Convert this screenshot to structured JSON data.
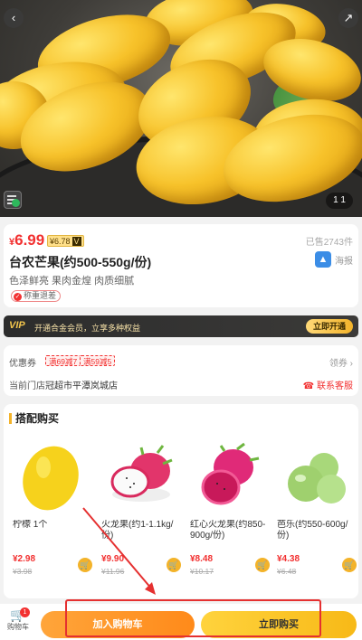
{
  "hero": {
    "image_counter": "1 1",
    "back_icon": "chevron-left-icon",
    "share_icon": "share-out-icon"
  },
  "product": {
    "currency": "¥",
    "price": "6.99",
    "vip_price": "¥6.78",
    "vip_tag": "V",
    "sold": "已售2743件",
    "title": "台农芒果(约500-550g/份)",
    "subtitle": "色泽鲜亮 果肉金煌 肉质细腻",
    "refund_tag": "称重退差",
    "share_label": "海报"
  },
  "vip_banner": {
    "logo": "VIP",
    "text": "开通合金会员，立享多种权益",
    "button": "立即开通"
  },
  "coupons": {
    "label": "优惠券",
    "tags": [
      "满69减7",
      "满59减5"
    ],
    "get_label": "领券 ›"
  },
  "store": {
    "label": "当前门店",
    "name": "冠超市平潭岚城店",
    "service": "联系客服"
  },
  "combo": {
    "title": "搭配购买",
    "items": [
      {
        "name": "柠檬 1个",
        "price": "¥2.98",
        "old_price": "¥3.98"
      },
      {
        "name": "火龙果(约1-1.1kg/份)",
        "price": "¥9.90",
        "old_price": "¥11.96"
      },
      {
        "name": "红心火龙果(约850-900g/份)",
        "price": "¥8.48",
        "old_price": "¥10.17"
      },
      {
        "name": "芭乐(约550-600g/份)",
        "price": "¥4.38",
        "old_price": "¥6.48"
      }
    ]
  },
  "bottom_bar": {
    "cart_label": "购物车",
    "cart_badge": "1",
    "add_to_cart": "加入购物车",
    "buy_now": "立即购买"
  },
  "colors": {
    "price_red": "#f23030",
    "add_orange": "#ff8a1a",
    "buy_yellow": "#f7b917",
    "highlight_box": "#e53030"
  }
}
